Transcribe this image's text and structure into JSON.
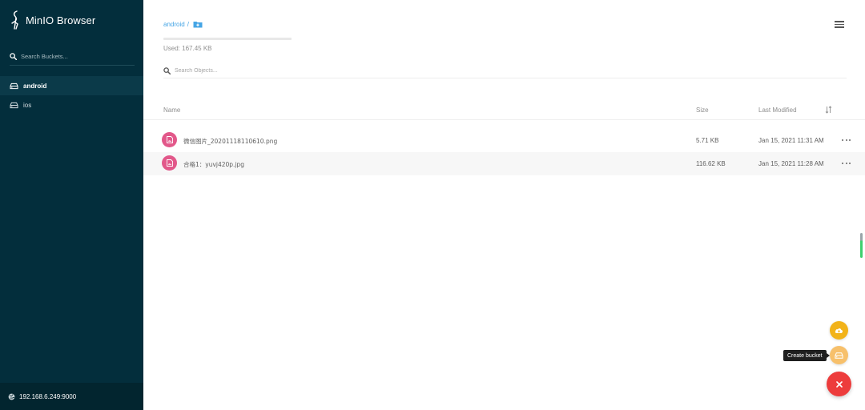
{
  "app": {
    "title": "MinIO Browser",
    "logo_icon": "minio-bird-logo-icon"
  },
  "sidebar": {
    "search_placeholder": "Search Buckets...",
    "buckets": [
      {
        "label": "android",
        "active": true,
        "icon": "bucket-icon"
      },
      {
        "label": "ios",
        "active": false,
        "icon": "bucket-icon"
      }
    ],
    "server_address": "192.168.6.249:9000",
    "server_icon": "globe-icon"
  },
  "header": {
    "breadcrumb": {
      "bucket": "android",
      "separator": "/",
      "folder_icon": "add-folder-icon"
    },
    "usage": {
      "text": "Used: 167.45 KB",
      "fraction": 0.0
    },
    "object_search_placeholder": "Search Objects..."
  },
  "table": {
    "columns": {
      "name": "Name",
      "size": "Size",
      "modified": "Last Modified"
    },
    "rows": [
      {
        "name": "微信图片_20201118110610.png",
        "size": "5.71 KB",
        "modified": "Jan 15, 2021 11:31 AM",
        "icon": "image-file-icon"
      },
      {
        "name": "合格1：yuvj420p.jpg",
        "size": "116.62 KB",
        "modified": "Jan 15, 2021 11:28 AM",
        "icon": "image-file-icon"
      }
    ]
  },
  "fab": {
    "tooltip": "Create bucket"
  },
  "colors": {
    "sidebar_bg": "#032e3c",
    "accent_link": "#46a5e5",
    "file_icon": "#e2588a",
    "fab_upload": "#f2b31a",
    "fab_bucket": "#f7c06b",
    "fab_close": "#ed3c3c"
  }
}
